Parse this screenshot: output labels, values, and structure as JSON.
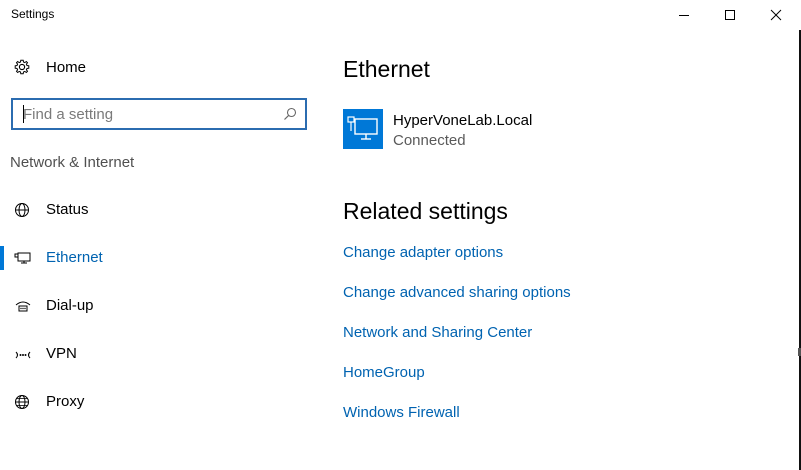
{
  "window": {
    "title": "Settings",
    "controls": {
      "minimize_icon": "minimize-icon",
      "maximize_icon": "maximize-icon",
      "close_icon": "close-icon"
    }
  },
  "sidebar": {
    "home_label": "Home",
    "search": {
      "placeholder": "Find a setting",
      "value": ""
    },
    "section_label": "Network & Internet",
    "items": [
      {
        "label": "Status",
        "icon": "globe-status-icon",
        "active": false
      },
      {
        "label": "Ethernet",
        "icon": "ethernet-icon",
        "active": true
      },
      {
        "label": "Dial-up",
        "icon": "dialup-icon",
        "active": false
      },
      {
        "label": "VPN",
        "icon": "vpn-icon",
        "active": false
      },
      {
        "label": "Proxy",
        "icon": "globe-icon",
        "active": false
      }
    ]
  },
  "main": {
    "title": "Ethernet",
    "connection": {
      "name": "HyperVoneLab.Local",
      "status": "Connected",
      "icon": "network-monitor-icon"
    },
    "related_title": "Related settings",
    "links": [
      "Change adapter options",
      "Change advanced sharing options",
      "Network and Sharing Center",
      "HomeGroup",
      "Windows Firewall"
    ]
  },
  "colors": {
    "accent": "#0078d7",
    "link": "#0063b1",
    "search_border": "#2b6cb0"
  }
}
